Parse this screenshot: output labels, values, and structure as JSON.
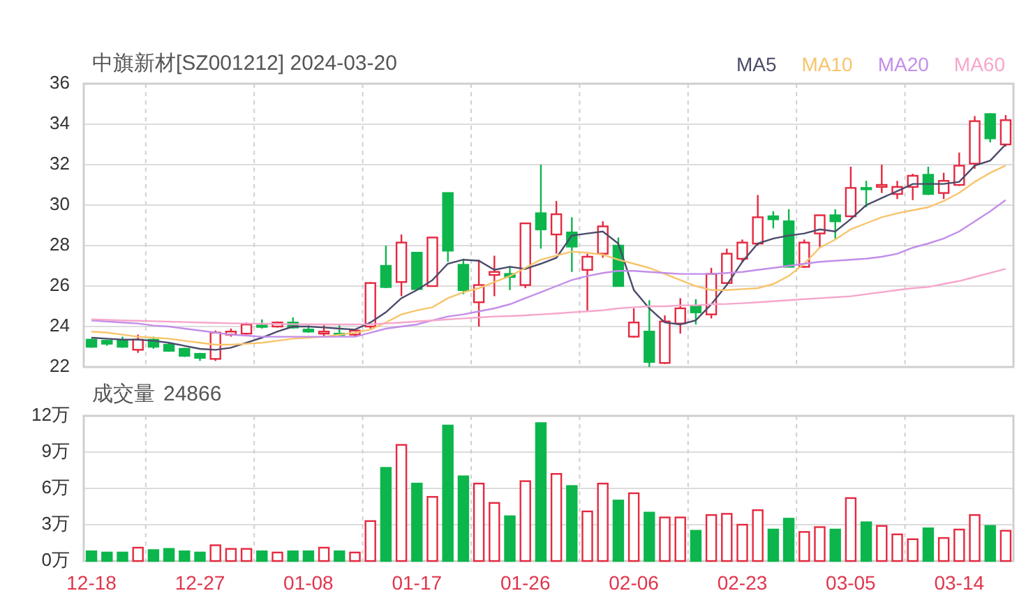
{
  "price_panel": {
    "title": "中旗新材[SZ001212] 2024-03-20",
    "chart_data": {
      "type": "candlestick",
      "ylim": [
        22,
        36
      ],
      "yticks": [
        22,
        24,
        26,
        28,
        30,
        32,
        34,
        36
      ],
      "grid": true,
      "categories": [
        null,
        null,
        null,
        null,
        null,
        null,
        null,
        null,
        null,
        null,
        null,
        null,
        null,
        null,
        null,
        null,
        null,
        null,
        null,
        null,
        null,
        null,
        null,
        null,
        null,
        null,
        null,
        null,
        null,
        null,
        null,
        null,
        null,
        null,
        null,
        null,
        null,
        null,
        null,
        null,
        null,
        null,
        null,
        null,
        null,
        null,
        null,
        null,
        null,
        null,
        null,
        null,
        null,
        null,
        null,
        null,
        null,
        null,
        null,
        null
      ],
      "ohlc": [
        [
          23.35,
          23.4,
          22.95,
          23.0
        ],
        [
          23.3,
          23.35,
          23.05,
          23.15
        ],
        [
          23.3,
          23.5,
          22.95,
          23.0
        ],
        [
          22.85,
          23.6,
          22.7,
          23.35
        ],
        [
          23.35,
          23.5,
          22.9,
          23.0
        ],
        [
          23.1,
          23.2,
          22.75,
          22.8
        ],
        [
          22.9,
          22.95,
          22.5,
          22.55
        ],
        [
          22.65,
          22.7,
          22.3,
          22.45
        ],
        [
          22.4,
          23.8,
          22.3,
          23.7
        ],
        [
          23.6,
          23.9,
          23.5,
          23.75
        ],
        [
          23.65,
          24.2,
          23.6,
          24.1
        ],
        [
          24.05,
          24.35,
          23.9,
          24.0
        ],
        [
          24.0,
          24.25,
          23.95,
          24.2
        ],
        [
          24.2,
          24.45,
          23.9,
          23.95
        ],
        [
          23.85,
          24.05,
          23.7,
          23.75
        ],
        [
          23.65,
          24.1,
          23.5,
          23.75
        ],
        [
          23.65,
          24.1,
          23.55,
          23.6
        ],
        [
          23.6,
          23.85,
          23.5,
          23.8
        ],
        [
          24.0,
          26.2,
          23.9,
          26.15
        ],
        [
          27.0,
          28.0,
          25.9,
          25.95
        ],
        [
          26.2,
          28.55,
          25.5,
          28.15
        ],
        [
          27.65,
          27.65,
          25.8,
          25.85
        ],
        [
          26.0,
          28.4,
          26.0,
          28.4
        ],
        [
          30.6,
          30.6,
          27.2,
          27.75
        ],
        [
          27.05,
          27.35,
          25.6,
          25.8
        ],
        [
          25.2,
          27.3,
          24.0,
          26.05
        ],
        [
          26.55,
          27.5,
          25.5,
          26.7
        ],
        [
          26.6,
          27.0,
          25.8,
          26.45
        ],
        [
          26.05,
          29.1,
          25.9,
          29.1
        ],
        [
          29.6,
          32.0,
          27.85,
          28.8
        ],
        [
          28.55,
          30.2,
          27.6,
          29.55
        ],
        [
          28.65,
          29.4,
          26.7,
          27.95
        ],
        [
          26.8,
          27.6,
          24.8,
          27.45
        ],
        [
          27.6,
          29.2,
          27.4,
          28.95
        ],
        [
          28.0,
          28.4,
          26.0,
          26.0
        ],
        [
          23.5,
          24.9,
          23.45,
          24.2
        ],
        [
          23.75,
          25.3,
          22.0,
          22.25
        ],
        [
          22.2,
          24.55,
          22.15,
          24.25
        ],
        [
          24.15,
          25.4,
          23.65,
          24.9
        ],
        [
          25.0,
          25.35,
          24.1,
          24.7
        ],
        [
          24.6,
          26.9,
          24.4,
          26.6
        ],
        [
          26.15,
          27.85,
          26.1,
          27.6
        ],
        [
          27.35,
          28.3,
          27.2,
          28.15
        ],
        [
          28.1,
          30.5,
          28.0,
          29.4
        ],
        [
          29.45,
          29.7,
          28.85,
          29.3
        ],
        [
          29.2,
          29.8,
          26.95,
          26.95
        ],
        [
          26.95,
          28.3,
          26.9,
          28.15
        ],
        [
          28.6,
          29.5,
          27.9,
          29.5
        ],
        [
          29.5,
          29.8,
          28.35,
          29.2
        ],
        [
          29.45,
          31.9,
          29.4,
          30.85
        ],
        [
          30.85,
          31.2,
          29.9,
          30.8
        ],
        [
          30.9,
          32.0,
          30.6,
          31.0
        ],
        [
          30.55,
          31.2,
          30.3,
          30.9
        ],
        [
          30.9,
          31.55,
          30.25,
          31.45
        ],
        [
          31.5,
          31.9,
          30.5,
          30.55
        ],
        [
          30.6,
          31.6,
          30.3,
          31.2
        ],
        [
          31.0,
          32.6,
          30.95,
          31.95
        ],
        [
          32.05,
          34.4,
          31.8,
          34.15
        ],
        [
          34.5,
          34.55,
          33.1,
          33.3
        ],
        [
          33.0,
          34.45,
          32.9,
          34.2
        ]
      ]
    }
  },
  "moving_averages": {
    "chart_data": {
      "type": "line",
      "ylim": [
        22,
        36
      ],
      "series": [
        {
          "name": "MA5",
          "color": "#4b4a6b",
          "values": [
            23.45,
            23.4,
            23.35,
            23.35,
            23.3,
            23.2,
            23.05,
            22.9,
            22.85,
            22.95,
            23.2,
            23.45,
            23.75,
            24.0,
            24.0,
            23.95,
            23.9,
            23.85,
            24.2,
            24.7,
            25.4,
            25.8,
            26.3,
            27.1,
            27.3,
            27.25,
            26.8,
            26.95,
            26.85,
            27.1,
            27.4,
            28.5,
            28.6,
            28.7,
            28.1,
            25.8,
            24.9,
            24.2,
            24.1,
            24.3,
            25.1,
            26.05,
            27.2,
            28.1,
            28.35,
            28.5,
            28.6,
            28.8,
            28.7,
            29.3,
            30.0,
            30.35,
            30.7,
            31.05,
            31.05,
            31.05,
            31.15,
            31.95,
            32.2,
            33.0
          ]
        },
        {
          "name": "MA10",
          "color": "#f7c46c",
          "values": [
            23.75,
            23.7,
            23.6,
            23.5,
            23.45,
            23.4,
            23.3,
            23.2,
            23.1,
            23.1,
            23.15,
            23.2,
            23.3,
            23.4,
            23.45,
            23.5,
            23.6,
            23.7,
            23.85,
            24.2,
            24.6,
            24.8,
            24.95,
            25.4,
            25.7,
            25.9,
            26.2,
            26.5,
            26.9,
            27.3,
            27.5,
            27.7,
            27.65,
            27.55,
            27.3,
            27.1,
            26.9,
            26.6,
            26.3,
            26.0,
            25.8,
            25.8,
            25.85,
            25.9,
            26.1,
            26.5,
            27.1,
            27.9,
            28.3,
            28.8,
            29.1,
            29.4,
            29.6,
            29.75,
            29.9,
            30.2,
            30.6,
            31.15,
            31.6,
            31.95
          ]
        },
        {
          "name": "MA20",
          "color": "#c28ee9",
          "values": [
            24.3,
            24.25,
            24.2,
            24.15,
            24.05,
            24.0,
            23.9,
            23.8,
            23.7,
            23.6,
            23.55,
            23.5,
            23.5,
            23.5,
            23.5,
            23.5,
            23.5,
            23.5,
            23.7,
            23.9,
            24.0,
            24.1,
            24.3,
            24.5,
            24.6,
            24.75,
            24.9,
            25.1,
            25.4,
            25.7,
            26.0,
            26.3,
            26.5,
            26.65,
            26.75,
            26.75,
            26.7,
            26.65,
            26.6,
            26.6,
            26.6,
            26.65,
            26.7,
            26.8,
            26.9,
            27.0,
            27.1,
            27.2,
            27.25,
            27.3,
            27.35,
            27.45,
            27.6,
            27.9,
            28.1,
            28.35,
            28.7,
            29.2,
            29.7,
            30.25
          ]
        },
        {
          "name": "MA60",
          "color": "#f6a6cb",
          "values": [
            24.35,
            24.33,
            24.3,
            24.28,
            24.26,
            24.24,
            24.22,
            24.2,
            24.18,
            24.16,
            24.15,
            24.14,
            24.13,
            24.12,
            24.11,
            24.1,
            24.1,
            24.1,
            24.12,
            24.15,
            24.2,
            24.25,
            24.3,
            24.35,
            24.4,
            24.45,
            24.5,
            24.52,
            24.55,
            24.6,
            24.65,
            24.7,
            24.75,
            24.8,
            24.9,
            24.95,
            25.0,
            25.0,
            25.05,
            25.05,
            25.1,
            25.12,
            25.15,
            25.2,
            25.25,
            25.3,
            25.35,
            25.4,
            25.45,
            25.5,
            25.6,
            25.7,
            25.8,
            25.9,
            25.95,
            26.1,
            26.25,
            26.45,
            26.65,
            26.85
          ]
        }
      ]
    }
  },
  "volume_panel": {
    "value": "24866",
    "chart_data": {
      "type": "bar",
      "ylim": [
        0,
        12
      ],
      "grid": true,
      "yticks": [
        {
          "value": 0,
          "label": "0万"
        },
        {
          "value": 3,
          "label": "3万"
        },
        {
          "value": 6,
          "label": "6万"
        },
        {
          "value": 9,
          "label": "9万"
        },
        {
          "value": 12,
          "label": "12万"
        }
      ],
      "categories": [
        "12-18",
        null,
        null,
        null,
        null,
        null,
        null,
        "12-27",
        null,
        null,
        null,
        null,
        null,
        null,
        "01-08",
        null,
        null,
        null,
        null,
        null,
        null,
        "01-17",
        null,
        null,
        null,
        null,
        null,
        null,
        "01-26",
        null,
        null,
        null,
        null,
        null,
        null,
        "02-06",
        null,
        null,
        null,
        null,
        null,
        null,
        "02-23",
        null,
        null,
        null,
        null,
        null,
        null,
        "03-05",
        null,
        null,
        null,
        null,
        null,
        null,
        "03-14",
        null,
        null,
        null
      ],
      "series": [
        {
          "name": "成交量",
          "values": [
            0.8,
            0.7,
            0.7,
            1.1,
            0.9,
            1.0,
            0.8,
            0.7,
            1.3,
            1.0,
            1.0,
            0.8,
            0.7,
            0.8,
            0.8,
            1.1,
            0.8,
            0.7,
            3.3,
            7.7,
            9.6,
            6.4,
            5.3,
            11.2,
            7.0,
            6.4,
            4.8,
            3.7,
            6.6,
            11.4,
            7.2,
            6.2,
            4.1,
            6.4,
            5.0,
            5.6,
            4.0,
            3.6,
            3.6,
            2.5,
            3.8,
            3.9,
            3.0,
            4.2,
            2.6,
            3.5,
            2.4,
            2.8,
            2.6,
            5.2,
            3.2,
            2.9,
            2.2,
            1.8,
            2.7,
            1.9,
            2.6,
            3.8,
            2.9,
            2.5
          ]
        }
      ]
    }
  }
}
